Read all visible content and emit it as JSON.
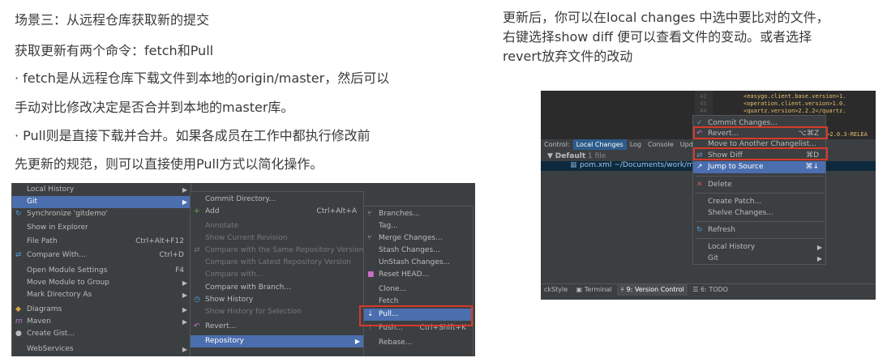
{
  "left_text": {
    "heading": "场景三：从远程仓库获取新的提交",
    "line1": "获取更新有两个命令：fetch和Pull",
    "line2": "· fetch是从远程仓库下载文件到本地的origin/master，然后可以",
    "line3": "手动对比修改决定是否合并到本地的master库。",
    "line4": "· Pull则是直接下载并合并。如果各成员在工作中都执行修改前",
    "line5": "先更新的规范，则可以直接使用Pull方式以简化操作。"
  },
  "right_text": {
    "line1": "更新后，你可以在local changes 中选中要比对的文件，",
    "line2": "右键选择show diff 便可以查看文件的变动。或者选择",
    "line3": "revert放弃文件的改动"
  },
  "left_ide": {
    "menu1": [
      {
        "label": "Local History",
        "shortcut": "",
        "arrow": true
      },
      {
        "label": "Git",
        "shortcut": "",
        "arrow": true
      },
      {
        "label": "Synchronize 'gitdemo'",
        "shortcut": ""
      },
      {
        "label": "Show in Explorer",
        "shortcut": ""
      },
      {
        "label": "File Path",
        "shortcut": "Ctrl+Alt+F12"
      },
      {
        "label": "Compare With...",
        "shortcut": "Ctrl+D"
      },
      {
        "label": "Open Module Settings",
        "shortcut": "F4"
      },
      {
        "label": "Move Module to Group",
        "shortcut": "",
        "arrow": true
      },
      {
        "label": "Mark Directory As",
        "shortcut": "",
        "arrow": true
      },
      {
        "label": "Diagrams",
        "shortcut": "",
        "arrow": true
      },
      {
        "label": "Maven",
        "shortcut": "",
        "arrow": true
      },
      {
        "label": "Create Gist...",
        "shortcut": ""
      },
      {
        "label": "WebServices",
        "shortcut": "",
        "arrow": true
      }
    ],
    "menu2": [
      {
        "label": "Commit Directory...",
        "shortcut": ""
      },
      {
        "label": "Add",
        "shortcut": "Ctrl+Alt+A"
      },
      {
        "label": "Annotate",
        "shortcut": ""
      },
      {
        "label": "Show Current Revision",
        "shortcut": ""
      },
      {
        "label": "Compare with the Same Repository Version",
        "shortcut": ""
      },
      {
        "label": "Compare with Latest Repository Version",
        "shortcut": ""
      },
      {
        "label": "Compare with...",
        "shortcut": ""
      },
      {
        "label": "Compare with Branch...",
        "shortcut": ""
      },
      {
        "label": "Show History",
        "shortcut": ""
      },
      {
        "label": "Show History for Selection",
        "shortcut": ""
      },
      {
        "label": "Revert...",
        "shortcut": ""
      },
      {
        "label": "Repository",
        "shortcut": ""
      }
    ],
    "menu3": [
      {
        "label": "Branches..."
      },
      {
        "label": "Tag..."
      },
      {
        "label": "Merge Changes..."
      },
      {
        "label": "Stash Changes..."
      },
      {
        "label": "UnStash Changes..."
      },
      {
        "label": "Reset HEAD..."
      },
      {
        "label": "Clone..."
      },
      {
        "label": "Fetch"
      },
      {
        "label": "Pull..."
      },
      {
        "label": "Push...",
        "shortcut": "Ctrl+Shift+K"
      },
      {
        "label": "Rebase..."
      }
    ]
  },
  "right_ide": {
    "gutter": [
      "42",
      "43",
      "44"
    ],
    "code": [
      "<easygo.client.base.version>1.",
      "<operation.client.version>1.0.",
      "<quartz.version>2.2.2</quartz.",
      "n>2.0.3-RELEA"
    ],
    "tabs": [
      "Control:",
      "Local Changes",
      "Log",
      "Console",
      "Update"
    ],
    "default_label": "Default",
    "default_count": "1 file",
    "file_name": "pom.xml",
    "file_path": "~/Documents/work/mtt/eas",
    "context_menu": [
      {
        "label": "Commit Changes...",
        "shortcut": ""
      },
      {
        "label": "Revert...",
        "shortcut": "⌥⌘Z"
      },
      {
        "label": "Move to Another Changelist...",
        "shortcut": ""
      },
      {
        "label": "Show Diff",
        "shortcut": "⌘D"
      },
      {
        "label": "Jump to Source",
        "shortcut": "⌘↓"
      },
      {
        "label": "Delete",
        "shortcut": ""
      },
      {
        "label": "Create Patch...",
        "shortcut": ""
      },
      {
        "label": "Shelve Changes...",
        "shortcut": ""
      },
      {
        "label": "Refresh",
        "shortcut": ""
      },
      {
        "label": "Local History",
        "shortcut": ""
      },
      {
        "label": "Git",
        "shortcut": ""
      }
    ],
    "bottom_tabs": [
      "ckStyle",
      "Terminal",
      "9: Version Control",
      "6: TODO"
    ]
  }
}
